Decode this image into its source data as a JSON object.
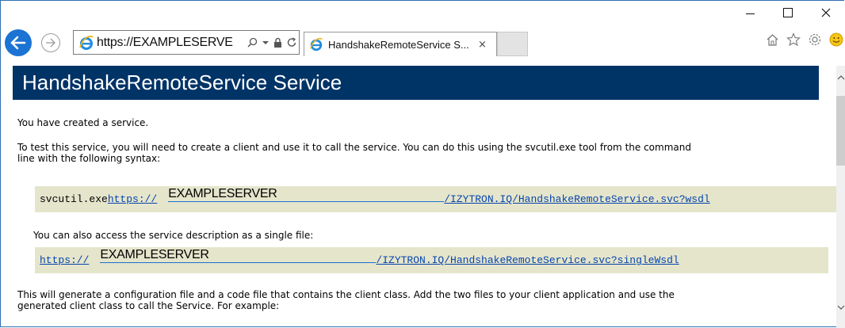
{
  "browser": {
    "address_url": "https://EXAMPLESERVE",
    "tab_title": "HandshakeRemoteService S...",
    "tab_close": "×"
  },
  "page": {
    "heading": "HandshakeRemoteService Service",
    "intro": "You have created a service.",
    "test_para_line1": "To test this service, you will need to create a client and use it to call the service. You can do this using the svcutil.exe tool from the command",
    "test_para_line2": "line with the following syntax:",
    "code1_cmd": "svcutil.exe ",
    "code1_link_prefix": "https://",
    "code1_server": "EXAMPLESERVER",
    "code1_link_suffix": "/IZYTRON.IQ/HandshakeRemoteService.svc?wsdl",
    "single_file_para": "You can also access the service description as a single file:",
    "code2_link_prefix": "https://",
    "code2_server": "EXAMPLESERVER",
    "code2_link_suffix": "/IZYTRON.IQ/HandshakeRemoteService.svc?singleWsdl",
    "generate_para_line1": "This will generate a configuration file and a code file that contains the client class. Add the two files to your client application and use the",
    "generate_para_line2": "generated client class to call the Service. For example:"
  },
  "colors": {
    "heading_bg": "#003366",
    "code_bg": "#e5e5cc",
    "link": "#0645ad",
    "back_button": "#1b73d3"
  },
  "icons": [
    "minimize-icon",
    "maximize-icon",
    "close-icon",
    "back-arrow-icon",
    "forward-arrow-icon",
    "search-icon",
    "dropdown-icon",
    "lock-icon",
    "refresh-icon",
    "ie-logo-icon",
    "home-icon",
    "favorites-star-icon",
    "settings-gear-icon",
    "smiley-feedback-icon"
  ]
}
